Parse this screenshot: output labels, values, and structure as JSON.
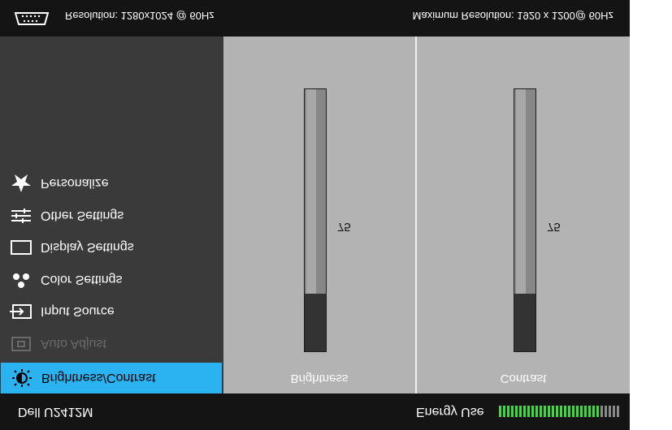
{
  "header": {
    "connector_icon": "vga-connector-icon",
    "current_resolution": "Resolution: 1280x1024 @ 60Hz",
    "max_resolution": "Maximum Resolution: 1920 x 1200@ 60Hz"
  },
  "menu": {
    "items": [
      {
        "label": "Personalize",
        "icon": "star-icon",
        "state": "normal"
      },
      {
        "label": "Other Settings",
        "icon": "sliders-icon",
        "state": "normal"
      },
      {
        "label": "Display Settings",
        "icon": "display-icon",
        "state": "normal"
      },
      {
        "label": "Color Settings",
        "icon": "color-dots-icon",
        "state": "normal"
      },
      {
        "label": "Input Source",
        "icon": "input-icon",
        "state": "normal"
      },
      {
        "label": "Auto Adjust",
        "icon": "auto-adjust-icon",
        "state": "disabled"
      },
      {
        "label": "Brightness/Contrast",
        "icon": "brightness-icon",
        "state": "selected"
      }
    ]
  },
  "brightness": {
    "label": "Brightness",
    "value": "75",
    "level": 0.22
  },
  "contrast": {
    "label": "Contrast",
    "value": "75",
    "level": 0.22
  },
  "footer": {
    "model": "Dell U2412M",
    "energy_label": "Energy Use",
    "energy_level": 0.82
  },
  "colors": {
    "accent": "#2ab3f0",
    "energy_on": "#3ddc3d",
    "energy_off": "#8a8a8a"
  }
}
